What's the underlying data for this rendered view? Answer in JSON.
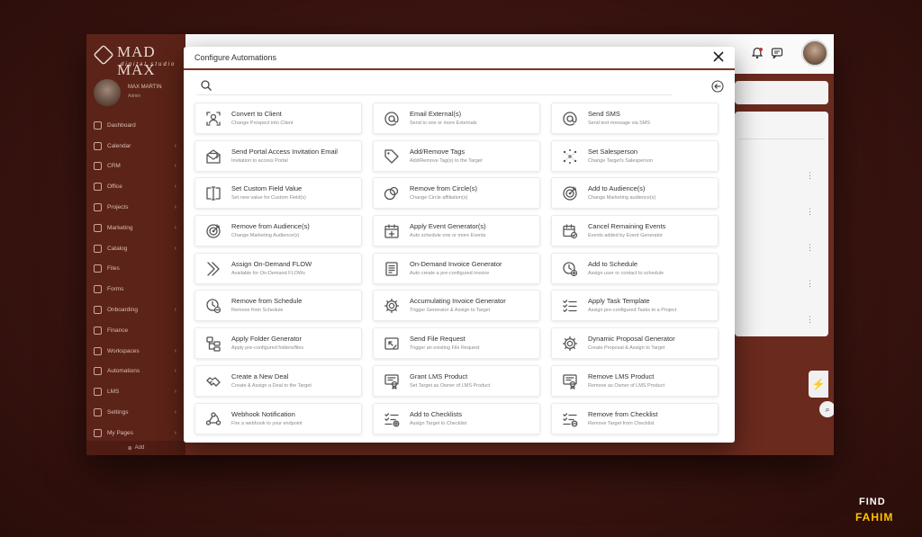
{
  "app": {
    "logo_text": "MAD MAX",
    "logo_sub": "digital studio",
    "profile_name": "MAX MARTIN",
    "profile_role": "Admin"
  },
  "sidebar_items": [
    {
      "label": "Dashboard",
      "chevron": false
    },
    {
      "label": "Calendar",
      "chevron": true
    },
    {
      "label": "CRM",
      "chevron": true
    },
    {
      "label": "Office",
      "chevron": true
    },
    {
      "label": "Projects",
      "chevron": true
    },
    {
      "label": "Marketing",
      "chevron": true
    },
    {
      "label": "Catalog",
      "chevron": true
    },
    {
      "label": "Files",
      "chevron": false
    },
    {
      "label": "Forms",
      "chevron": false
    },
    {
      "label": "Onboarding",
      "chevron": true
    },
    {
      "label": "Finance",
      "chevron": false
    },
    {
      "label": "Workspaces",
      "chevron": true
    },
    {
      "label": "Automations",
      "chevron": true
    },
    {
      "label": "LMS",
      "chevron": true
    },
    {
      "label": "Settings",
      "chevron": true
    },
    {
      "label": "My Pages",
      "chevron": true
    }
  ],
  "sidebar_footer": "Add",
  "modal": {
    "title": "Configure Automations",
    "search_placeholder": "",
    "search_value": ""
  },
  "automations": [
    {
      "title": "Convert to Client",
      "desc": "Change Prospect into Client",
      "icon": "user-frame-icon"
    },
    {
      "title": "Email External(s)",
      "desc": "Send to one or more Externals",
      "icon": "at-icon"
    },
    {
      "title": "Send SMS",
      "desc": "Send text message via SMS",
      "icon": "at-icon"
    },
    {
      "title": "Send Portal Access Invitation Email",
      "desc": "Invitation to access Portal",
      "icon": "envelope-open-icon"
    },
    {
      "title": "Add/Remove Tags",
      "desc": "Add/Remove Tag(s) to the Target",
      "icon": "tag-icon"
    },
    {
      "title": "Set Salesperson",
      "desc": "Change Target's Salesperson",
      "icon": "network-icon"
    },
    {
      "title": "Set Custom Field Value",
      "desc": "Set new value for Custom Field(s)",
      "icon": "cursor-field-icon"
    },
    {
      "title": "Remove from Circle(s)",
      "desc": "Change Circle affiliation(s)",
      "icon": "circles-icon"
    },
    {
      "title": "Add to Audience(s)",
      "desc": "Change Marketing audience(s)",
      "icon": "target-icon"
    },
    {
      "title": "Remove from Audience(s)",
      "desc": "Change Marketing Audience(s)",
      "icon": "target-icon"
    },
    {
      "title": "Apply Event Generator(s)",
      "desc": "Auto schedule one or more Events",
      "icon": "calendar-plus-icon"
    },
    {
      "title": "Cancel Remaining Events",
      "desc": "Events added by Event Generator",
      "icon": "calendar-check-icon"
    },
    {
      "title": "Assign On-Demand FLOW",
      "desc": "Available for On-Demand FLOWs",
      "icon": "double-chevron-icon"
    },
    {
      "title": "On-Demand Invoice Generator",
      "desc": "Auto create a pre-configured invoice",
      "icon": "invoice-icon"
    },
    {
      "title": "Add to Schedule",
      "desc": "Assign user or contact to schedule",
      "icon": "clock-plus-icon"
    },
    {
      "title": "Remove from Schedule",
      "desc": "Remove from Schedule",
      "icon": "clock-minus-icon"
    },
    {
      "title": "Accumulating Invoice Generator",
      "desc": "Trigger Generator & Assign to Target",
      "icon": "gear-icon"
    },
    {
      "title": "Apply Task Template",
      "desc": "Assign pre-configured Tasks to a Project",
      "icon": "checklist-icon"
    },
    {
      "title": "Apply Folder Generator",
      "desc": "Apply pre-configured folders/files",
      "icon": "folder-tree-icon"
    },
    {
      "title": "Send File Request",
      "desc": "Trigger an existing File Request",
      "icon": "file-request-icon"
    },
    {
      "title": "Dynamic Proposal Generator",
      "desc": "Create Proposal & Assign to Target",
      "icon": "gear-icon"
    },
    {
      "title": "Create a New Deal",
      "desc": "Create & Assign a Deal to the Target",
      "icon": "handshake-icon"
    },
    {
      "title": "Grant LMS Product",
      "desc": "Set Target as Owner of LMS Product",
      "icon": "certificate-icon"
    },
    {
      "title": "Remove LMS Product",
      "desc": "Remove as Owner of LMS Product",
      "icon": "certificate-icon"
    },
    {
      "title": "Webhook Notification",
      "desc": "Fire a webhook to your endpoint",
      "icon": "webhook-icon"
    },
    {
      "title": "Add to Checklists",
      "desc": "Assign Target to Checklist",
      "icon": "checklist-add-icon"
    },
    {
      "title": "Remove from Checklist",
      "desc": "Remove Target from Checklist",
      "icon": "checklist-remove-icon"
    }
  ],
  "watermark": {
    "line1": "FIND",
    "line2": "FAHIM"
  },
  "colors": {
    "accent": "#7a3425",
    "icon": "#555555",
    "sidebar": "#5c2318"
  }
}
